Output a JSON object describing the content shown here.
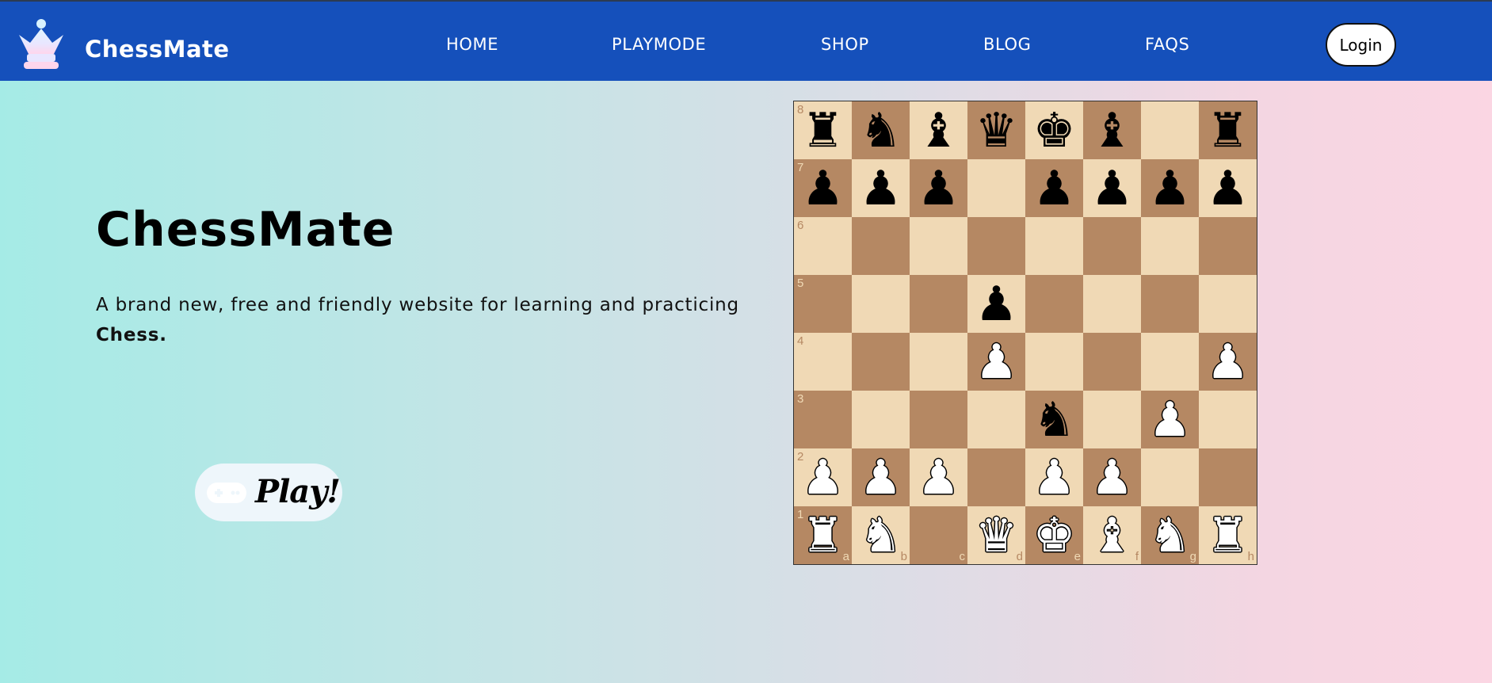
{
  "navbar": {
    "brand": "ChessMate",
    "links": [
      "HOME",
      "PLAYMODE",
      "SHOP",
      "BLOG",
      "FAQS"
    ],
    "login_label": "Login",
    "background": "#1550bb"
  },
  "hero": {
    "title": "ChessMate",
    "description": "A brand new, free and friendly website for learning and practicing",
    "description_bold": "Chess.",
    "play_label": "Play!"
  },
  "board": {
    "files": [
      "a",
      "b",
      "c",
      "d",
      "e",
      "f",
      "g",
      "h"
    ],
    "ranks": [
      "8",
      "7",
      "6",
      "5",
      "4",
      "3",
      "2",
      "1"
    ],
    "light_color": "#f0d9b5",
    "dark_color": "#b58863",
    "rows": [
      [
        "r",
        "n",
        "b",
        "q",
        "k",
        "b",
        "",
        "r"
      ],
      [
        "p",
        "p",
        "p",
        "",
        "p",
        "p",
        "p",
        "p"
      ],
      [
        "",
        "",
        "",
        "",
        "",
        "",
        "",
        ""
      ],
      [
        "",
        "",
        "",
        "p",
        "",
        "",
        "",
        ""
      ],
      [
        "",
        "",
        "",
        "P",
        "",
        "",
        "",
        "P"
      ],
      [
        "",
        "",
        "",
        "",
        "n",
        "",
        "P",
        ""
      ],
      [
        "P",
        "P",
        "P",
        "",
        "P",
        "P",
        "",
        ""
      ],
      [
        "R",
        "N",
        "",
        "Q",
        "K",
        "B",
        "N",
        "R"
      ]
    ]
  }
}
